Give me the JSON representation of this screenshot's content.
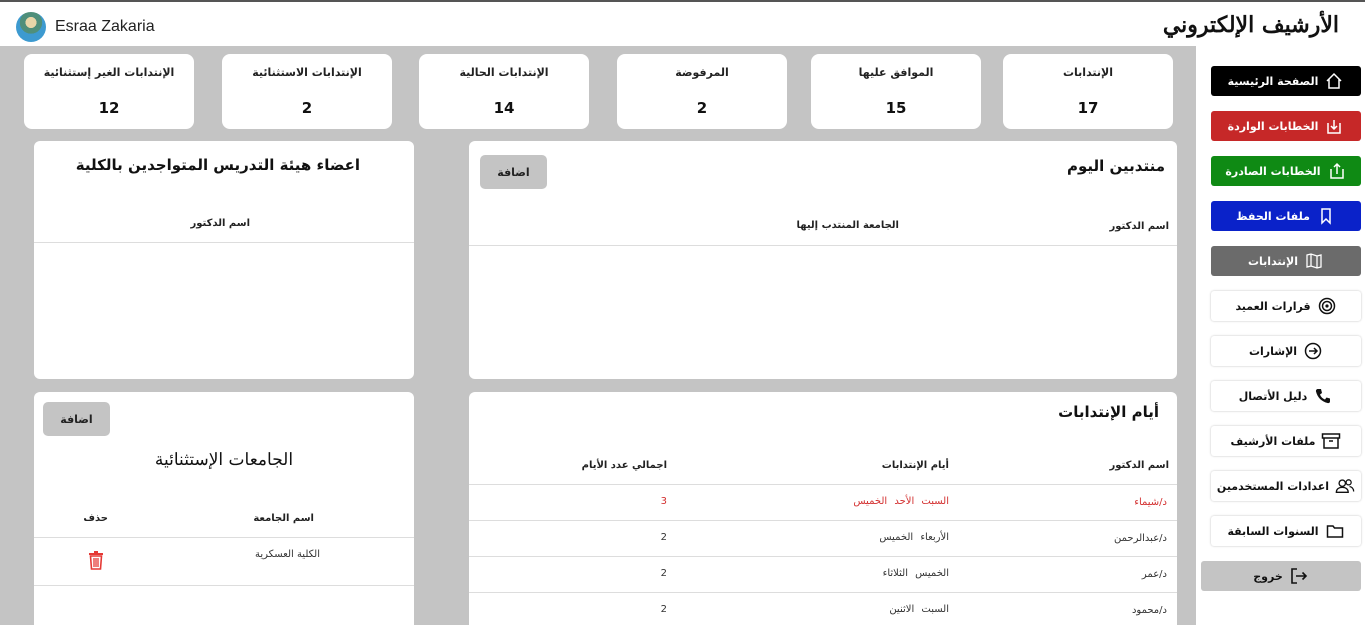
{
  "header": {
    "user_name": "Esraa Zakaria",
    "app_title": "الأرشيف الإلكتروني"
  },
  "stats": [
    {
      "label": "الإنتدابات",
      "value": "17"
    },
    {
      "label": "الموافق عليها",
      "value": "15"
    },
    {
      "label": "المرفوضة",
      "value": "2"
    },
    {
      "label": "الإنتدابات الحالية",
      "value": "14"
    },
    {
      "label": "الإنتدابات الاستثنائية",
      "value": "2"
    },
    {
      "label": "الإنتدابات الغير إستثنائية",
      "value": "12"
    }
  ],
  "today_panel": {
    "title": "منتدبين اليوم",
    "add_label": "اضافة",
    "col_doctor": "اسم الدكتور",
    "col_university": "الجامعة المنتدب إليها"
  },
  "faculty_panel": {
    "title": "اعضاء هيئة التدريس المتواجدين بالكلية",
    "col_doctor": "اسم الدكتور"
  },
  "days_panel": {
    "title": "أيام الإنتدابات",
    "col_doctor": "اسم الدكتور",
    "col_days": "أيام الإنتدابات",
    "col_total": "اجمالي عدد الأيام",
    "rows": [
      {
        "doctor": "د/شيماء",
        "days": "السبت   الأحد   الخميس",
        "total": "3",
        "highlight": true
      },
      {
        "doctor": "د/عبدالرحمن",
        "days": "الأربعاء   الخميس",
        "total": "2",
        "highlight": false
      },
      {
        "doctor": "د/عمر",
        "days": "الخميس   الثلاثاء",
        "total": "2",
        "highlight": false
      },
      {
        "doctor": "د/محمود",
        "days": "السبت   الاثنين",
        "total": "2",
        "highlight": false
      }
    ]
  },
  "universities_panel": {
    "title": "الجامعات الإستثنائية",
    "add_label": "اضافة",
    "col_name": "اسم الجامعة",
    "col_delete": "حذف",
    "rows": [
      {
        "name": "الكلية العسكرية"
      }
    ]
  },
  "sidebar": {
    "items": [
      {
        "label": "الصفحة الرئيسية",
        "icon": "home-icon",
        "bg": "#000000",
        "fg": "#ffffff"
      },
      {
        "label": "الخطابات الواردة",
        "icon": "inbox-download-icon",
        "bg": "#c62828",
        "fg": "#ffffff"
      },
      {
        "label": "الخطابات الصادرة",
        "icon": "outbox-upload-icon",
        "bg": "#0f8a14",
        "fg": "#ffffff"
      },
      {
        "label": "ملفات الحفظ",
        "icon": "bookmark-icon",
        "bg": "#0a22c9",
        "fg": "#ffffff"
      },
      {
        "label": "الإنتدابات",
        "icon": "map-icon",
        "bg": "#6b6b6b",
        "fg": "#ffffff"
      },
      {
        "label": "قرارات العميد",
        "icon": "target-icon",
        "bg": "#ffffff",
        "fg": "#111111"
      },
      {
        "label": "الإشارات",
        "icon": "arrow-circle-icon",
        "bg": "#ffffff",
        "fg": "#111111"
      },
      {
        "label": "دليل الأتصال",
        "icon": "phone-icon",
        "bg": "#ffffff",
        "fg": "#111111"
      },
      {
        "label": "ملفات الأرشيف",
        "icon": "archive-box-icon",
        "bg": "#ffffff",
        "fg": "#111111"
      },
      {
        "label": "اعدادات المستخدمين",
        "icon": "users-icon",
        "bg": "#ffffff",
        "fg": "#111111"
      },
      {
        "label": "السنوات السابقة",
        "icon": "folder-icon",
        "bg": "#ffffff",
        "fg": "#111111"
      }
    ],
    "logout_label": "خروج",
    "logout_icon": "logout-icon"
  }
}
